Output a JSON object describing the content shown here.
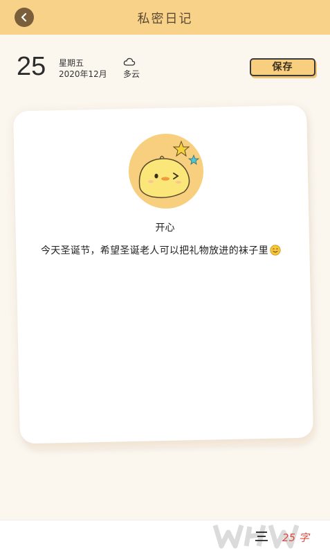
{
  "header": {
    "title": "私密日记",
    "back_icon": "back-arrow-icon"
  },
  "date": {
    "day": "25",
    "weekday": "星期五",
    "year_month": "2020年12月"
  },
  "weather": {
    "icon": "cloud-icon",
    "label": "多云"
  },
  "toolbar": {
    "save_label": "保存"
  },
  "entry": {
    "mood_icon": "happy-chick-icon",
    "mood_label": "开心",
    "text": "今天圣诞节，希望圣诞老人可以把礼物放进的袜子里",
    "emoji": "smiling-face-icon"
  },
  "bottom_bar": {
    "menu_icon": "menu-icon",
    "watermark_text": "25 字"
  },
  "colors": {
    "header_bg": "#f8d289",
    "page_bg": "#fbf6ee",
    "save_bg": "#f7cf7e",
    "avatar_bg": "#f7cf7e",
    "accent_star_yellow": "#f5d13a",
    "accent_star_cyan": "#4dc9d6"
  }
}
